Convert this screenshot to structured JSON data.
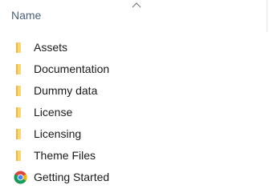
{
  "header": {
    "name_label": "Name",
    "sort_icon": "chevron-up-icon"
  },
  "colors": {
    "folder": "#f8d775",
    "folder_dark": "#e6b94a",
    "header_text": "#4c607a",
    "row_text": "#1a1a1a"
  },
  "files": [
    {
      "label": "Assets",
      "icon": "folder-icon"
    },
    {
      "label": "Documentation",
      "icon": "folder-icon"
    },
    {
      "label": "Dummy data",
      "icon": "folder-icon"
    },
    {
      "label": "License",
      "icon": "folder-icon"
    },
    {
      "label": "Licensing",
      "icon": "folder-icon"
    },
    {
      "label": "Theme Files",
      "icon": "folder-icon"
    },
    {
      "label": "Getting Started",
      "icon": "chrome-icon"
    }
  ]
}
